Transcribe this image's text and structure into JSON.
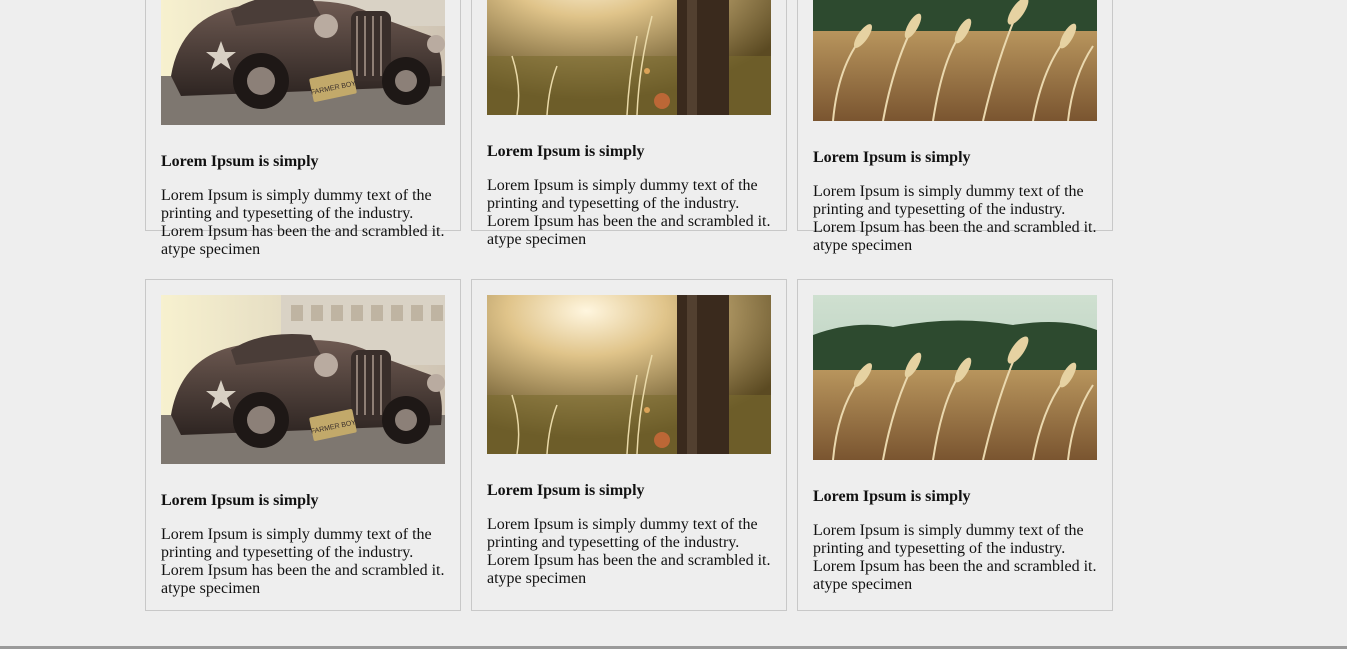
{
  "cards_row_top": [
    {
      "image_subject": "vintage-car",
      "title": "Lorem Ipsum is simply",
      "body": "Lorem Ipsum is simply dummy text of the printing and typesetting of the industry. Lorem Ipsum has been the and scrambled it. atype specimen",
      "plate_text": "FARMER BOY"
    },
    {
      "image_subject": "sunlit-meadow-tree",
      "title": "Lorem Ipsum is simply",
      "body": "Lorem Ipsum is simply dummy text of the printing and typesetting of the industry. Lorem Ipsum has been the and scrambled it. atype specimen"
    },
    {
      "image_subject": "wheat-field",
      "title": "Lorem Ipsum is simply",
      "body": "Lorem Ipsum is simply dummy text of the printing and typesetting of the industry. Lorem Ipsum has been the and scrambled it. atype specimen"
    }
  ],
  "cards_row_bottom": [
    {
      "image_subject": "vintage-car",
      "title": "Lorem Ipsum is simply",
      "body": "Lorem Ipsum is simply dummy text of the printing and typesetting of the industry. Lorem Ipsum has been the and scrambled it. atype specimen",
      "plate_text": "FARMER BOY"
    },
    {
      "image_subject": "sunlit-meadow-tree",
      "title": "Lorem Ipsum is simply",
      "body": "Lorem Ipsum is simply dummy text of the printing and typesetting of the industry. Lorem Ipsum has been the and scrambled it. atype specimen"
    },
    {
      "image_subject": "wheat-field",
      "title": "Lorem Ipsum is simply",
      "body": "Lorem Ipsum is simply dummy text of the printing and typesetting of the industry. Lorem Ipsum has been the and scrambled it. atype specimen"
    }
  ],
  "colors": {
    "page_background": "#eeeeee",
    "card_border": "#c8c8c8",
    "text": "#111111"
  }
}
